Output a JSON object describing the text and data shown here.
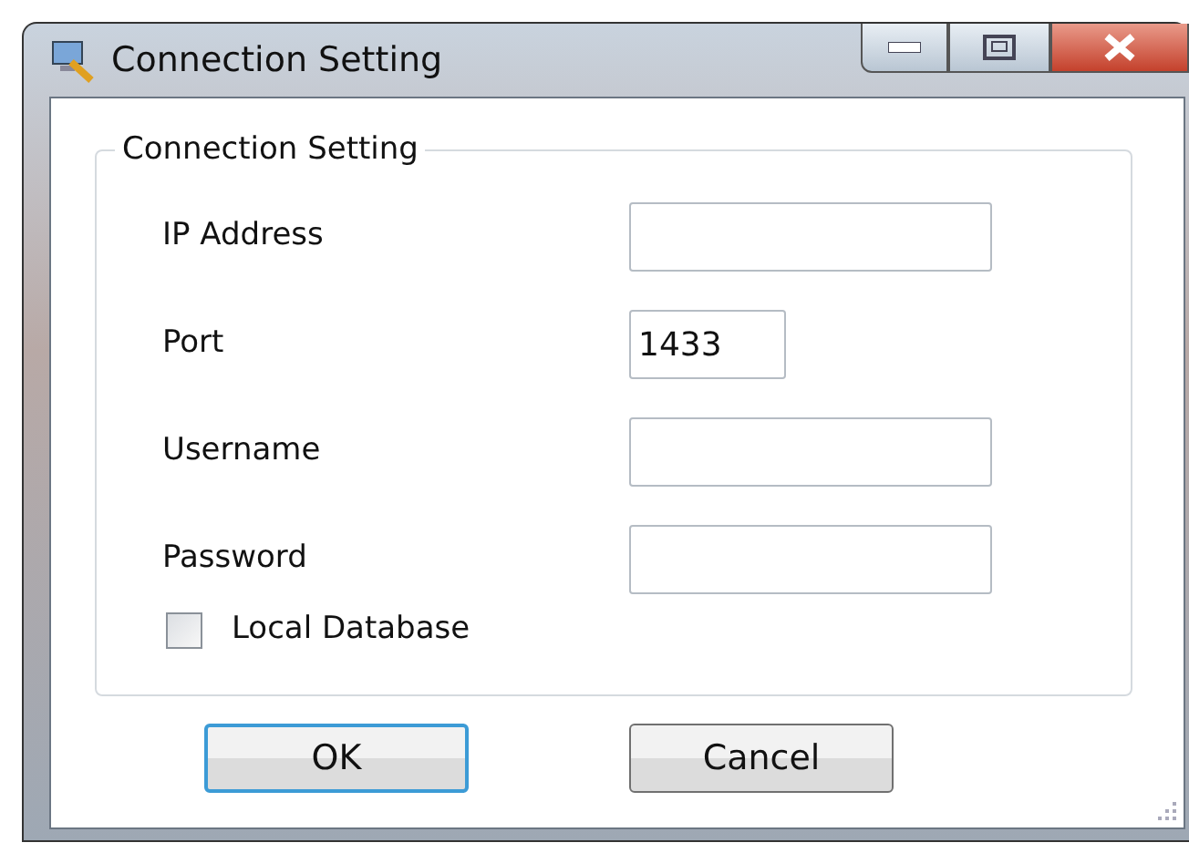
{
  "window": {
    "title": "Connection Setting"
  },
  "group": {
    "title": "Connection Setting"
  },
  "fields": [
    {
      "label": "IP Address",
      "kind": "text"
    },
    {
      "label": "Port",
      "value": "1433",
      "kind": "number"
    },
    {
      "label": "Username",
      "kind": "text"
    },
    {
      "label": "Password",
      "kind": "text"
    }
  ],
  "checkbox": {
    "label": "Local Database",
    "checked": false
  },
  "buttons": [
    {
      "label": "OK",
      "default": true
    },
    {
      "label": "Cancel",
      "default": false
    }
  ]
}
